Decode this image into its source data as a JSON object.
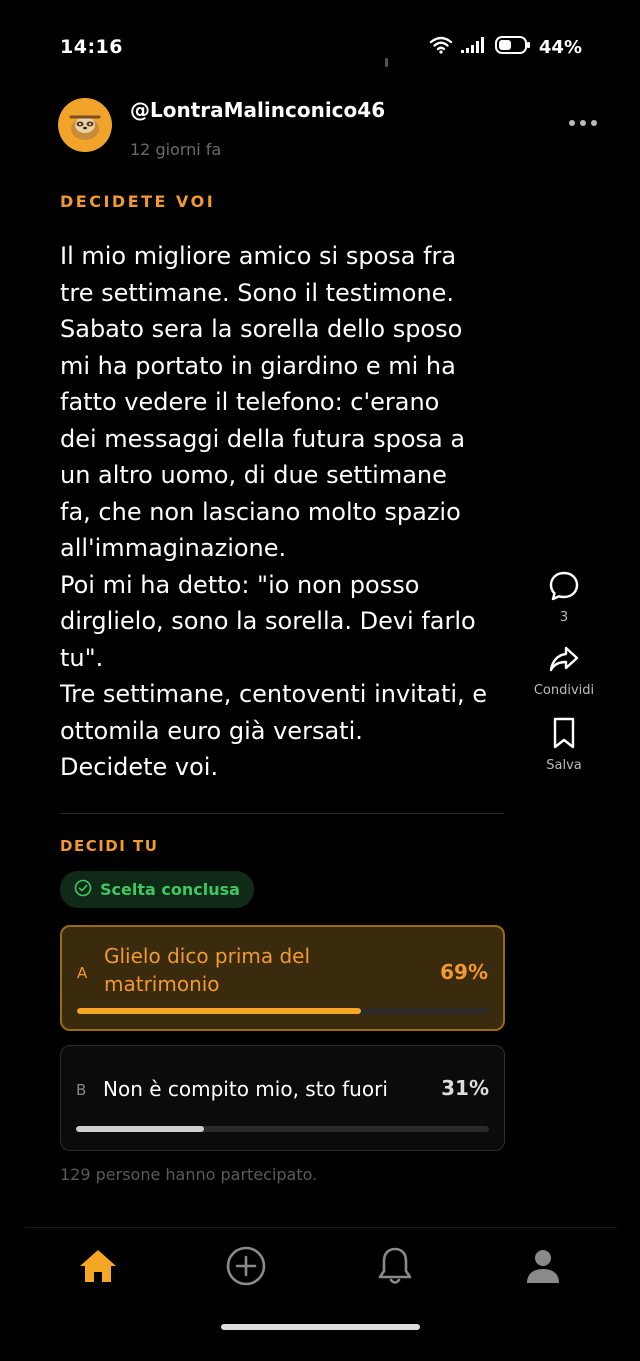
{
  "status_bar": {
    "time": "14:16",
    "battery": "44%"
  },
  "post": {
    "username": "@LontraMalinconico46",
    "time_ago": "12 giorni fa",
    "tag": "DECIDETE VOI",
    "body": "Il mio migliore amico si sposa fra\ntre settimane. Sono il testimone.\nSabato sera la sorella dello sposo\nmi ha portato in giardino e mi ha\nfatto vedere il telefono: c'erano\ndei messaggi della futura sposa a\nun altro uomo, di due settimane\nfa, che non lasciano molto spazio\nall'immaginazione.\nPoi mi ha detto: \"io non posso\ndirglielo, sono la sorella. Devi farlo\ntu\".\nTre settimane, centoventi invitati, e\nottomila euro già versati.\nDecidete voi."
  },
  "actions": {
    "comments_count": "3",
    "share_label": "Condividi",
    "save_label": "Salva"
  },
  "poll": {
    "title": "DECIDI TU",
    "status": "Scelta conclusa",
    "options": [
      {
        "letter": "A",
        "text": "Glielo dico prima del matrimonio",
        "percent_label": "69%",
        "percent": 69,
        "color": "#f5a623"
      },
      {
        "letter": "B",
        "text": "Non è compito mio, sto fuori",
        "percent_label": "31%",
        "percent": 31,
        "color": "#cfcfcf"
      }
    ],
    "participants": "129 persone hanno partecipato."
  },
  "colors": {
    "accent": "#f29a2e",
    "success": "#3fc761"
  },
  "nav": [
    "home-icon",
    "add-circle-icon",
    "bell-icon",
    "profile-icon"
  ]
}
